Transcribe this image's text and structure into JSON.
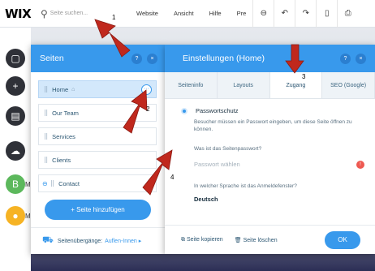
{
  "topbar": {
    "logo": "WIX",
    "search_placeholder": "Seite suchen...",
    "menu": [
      "Website",
      "Ansicht",
      "Hilfe",
      "Pre"
    ],
    "icons": [
      "zoom-icon",
      "undo-icon",
      "redo-icon",
      "mobile-icon",
      "preview-icon"
    ]
  },
  "leftbar": {
    "items": [
      {
        "icon": "pages-icon",
        "glyph": "▢"
      },
      {
        "icon": "add-icon",
        "glyph": "+"
      },
      {
        "icon": "background-icon",
        "glyph": "▤"
      },
      {
        "icon": "upload-icon",
        "glyph": "☁"
      },
      {
        "icon": "b-app-icon",
        "glyph": "B",
        "color": "#5cb85c",
        "label": "M"
      },
      {
        "icon": "blog-icon",
        "glyph": "●",
        "color": "#f6b324",
        "label": "M"
      }
    ]
  },
  "pages_panel": {
    "title": "Seiten",
    "help": "?",
    "close": "×",
    "pages": [
      {
        "label": "Home",
        "selected": true
      },
      {
        "label": "Our Team"
      },
      {
        "label": "Services"
      },
      {
        "label": "Clients"
      },
      {
        "label": "Contact"
      }
    ],
    "add_button": "+ Seite hinzufügen",
    "transitions_label": "Seitenübergänge:",
    "transitions_value": "Auflen-Innen ▸"
  },
  "settings_panel": {
    "title": "Einstellungen (Home)",
    "help": "?",
    "close": "×",
    "tabs": [
      "Seiteninfo",
      "Layouts",
      "Zugang",
      "SEO (Google)"
    ],
    "active_tab": "Zugang",
    "radio_label": "Passwortschutz",
    "radio_desc": "Besucher müssen ein Passwort eingeben, um diese Seite öffnen zu können.",
    "question1": "Was ist das Seitenpasswort?",
    "password_placeholder": "Passwort wählen",
    "warning": "!",
    "question2": "In welcher Sprache ist das Anmeldefenster?",
    "language": "Deutsch",
    "copy": "Seite kopieren",
    "delete": "Seite löschen",
    "ok": "OK"
  },
  "annotations": [
    "1",
    "2",
    "3",
    "4"
  ],
  "colors": {
    "accent": "#3899ec",
    "arrow": "#c0281d"
  }
}
